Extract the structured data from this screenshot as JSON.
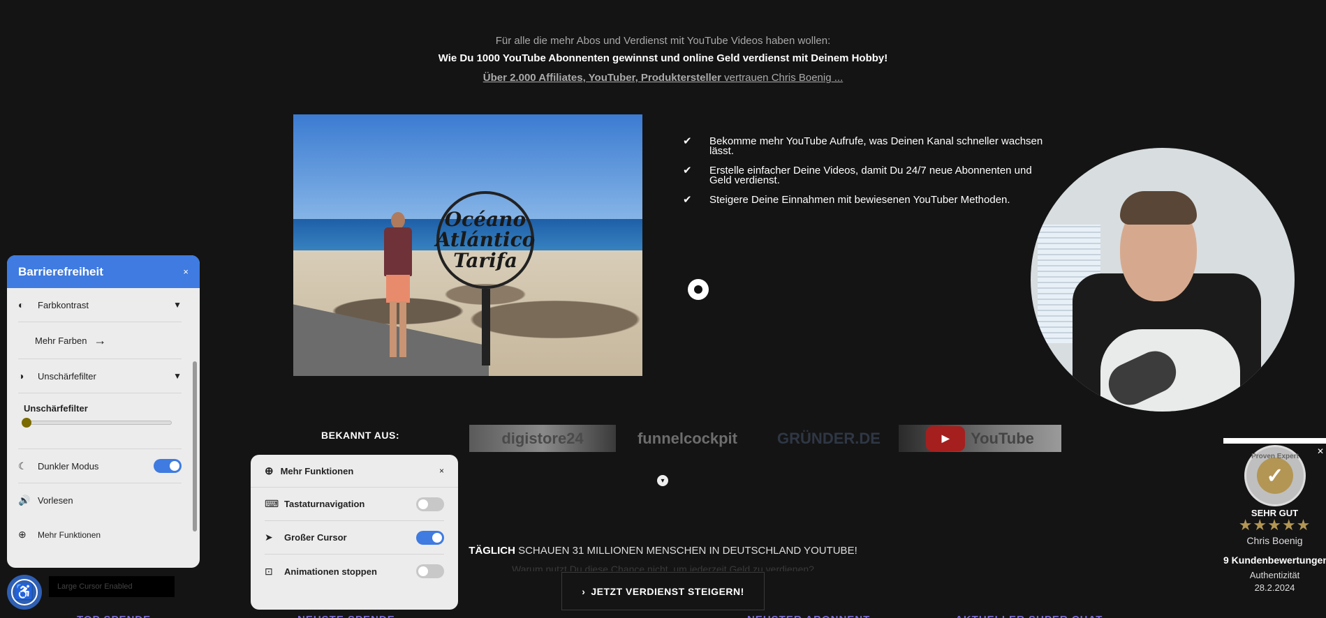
{
  "hero": {
    "pre_title": "Für alle die mehr Abos und Verdienst mit YouTube Videos haben wollen:",
    "main_title": "Wie Du 1000 YouTube Abonnenten gewinnst und online Geld verdienst mit Deinem Hobby!",
    "trust_bold": "Über 2.000 Affiliates, YouTuber, Produktersteller",
    "trust_rest": " vertrauen Chris Boenig ..."
  },
  "photo": {
    "sign_text": "Océano Atlántico Tarifa"
  },
  "checklist": [
    "Bekomme mehr YouTube Aufrufe, was Deinen Kanal schneller wachsen lässt.",
    "Erstelle einfacher Deine Videos, damit Du 24/7 neue Abonnenten und Geld verdienst.",
    "Steigere Deine Einnahmen mit bewiesenen YouTuber Methoden."
  ],
  "bekannt": {
    "label": "BEKANNT AUS:",
    "logos": [
      "digistore24",
      "funnelcockpit",
      "GRÜNDER.DE",
      "YouTube"
    ]
  },
  "stats": {
    "bold": "TÄGLICH",
    "rest": " SCHAUEN 31 MILLIONEN MENSCHEN IN DEUTSCHLAND YOUTUBE!",
    "faded": "Warum nutzt Du diese Chance nicht, um jederzeit Geld zu verdienen?"
  },
  "cta": {
    "label": "JETZT VERDIENST STEIGERN!"
  },
  "footer_headings": [
    "TOP SPENDE",
    "NEUSTE SPENDE",
    "NEUSTER ABONNENT",
    "AKTUELLER SUPER CHAT"
  ],
  "proven_expert": {
    "badge_text": "Proven Expert",
    "rating_label": "SEHR GUT",
    "stars": "★★★★★",
    "name": "Chris Boenig",
    "reviews": "9 Kundenbewertungen",
    "auth_label": "Authentizität",
    "date": "28.2.2024"
  },
  "accessibility": {
    "title": "Barrierefreiheit",
    "close": "×",
    "contrast_label": "Farbkontrast",
    "more_colors": "Mehr Farben",
    "blur_label": "Unschärfefilter",
    "blur_slider_label": "Unschärfefilter",
    "blur_level": 0,
    "dark_mode_label": "Dunkler Modus",
    "dark_mode_on": true,
    "read_aloud_label": "Vorlesen",
    "more_functions_label": "Mehr Funktionen",
    "toast": "Large Cursor Enabled"
  },
  "more_functions": {
    "title": "Mehr Funktionen",
    "close": "×",
    "items": [
      {
        "label": "Tastaturnavigation",
        "on": false
      },
      {
        "label": "Großer Cursor",
        "on": true
      },
      {
        "label": "Animationen stoppen",
        "on": false
      }
    ]
  },
  "colors": {
    "accent": "#3f7be0",
    "gold": "#b39654",
    "background": "#141414"
  }
}
